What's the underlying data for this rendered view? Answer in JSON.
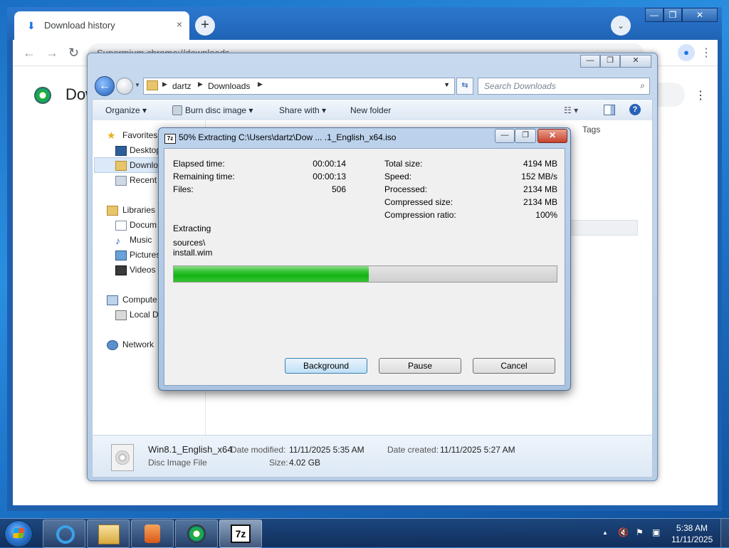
{
  "chrome": {
    "tab_title": "Download history",
    "tab_close": "×",
    "new_tab": "+",
    "tab_search": "⌄",
    "caption": {
      "minimize": "—",
      "restore": "❐",
      "close": "✕"
    },
    "back": "←",
    "forward": "→",
    "reload": "↻",
    "omnibox_text": "Supermium   chrome://downloads",
    "page_title": "Dow",
    "menu": "⋮"
  },
  "explorer": {
    "caption": {
      "minimize": "—",
      "restore": "❐",
      "close": "✕"
    },
    "back": "←",
    "breadcrumbs": [
      "dartz",
      "Downloads"
    ],
    "search_placeholder": "Search Downloads",
    "toolbar": {
      "organize": "Organize ▾",
      "burn": "Burn disc image ▾",
      "share": "Share with ▾",
      "new_folder": "New folder"
    },
    "nav": {
      "favorites": "Favorites",
      "desktop": "Desktop",
      "downloads": "Downlo",
      "recent": "Recent P",
      "libraries": "Libraries",
      "documents": "Docum",
      "music": "Music",
      "pictures": "Pictures",
      "videos": "Videos",
      "computer": "Compute",
      "local_disk": "Local Di",
      "network": "Network"
    },
    "column_tags": "Tags",
    "details": {
      "file_name": "Win8.1_English_x64",
      "file_type": "Disc Image File",
      "date_modified_label": "Date modified:",
      "date_modified": "11/11/2025 5:35 AM",
      "size_label": "Size:",
      "size": "4.02 GB",
      "date_created_label": "Date created:",
      "date_created": "11/11/2025 5:27 AM"
    }
  },
  "zip": {
    "title": "50% Extracting C:\\Users\\dartz\\Dow ... .1_English_x64.iso",
    "caption": {
      "minimize": "—",
      "restore": "❐",
      "close": "✕"
    },
    "left": [
      {
        "label": "Elapsed time:",
        "value": "00:00:14"
      },
      {
        "label": "Remaining time:",
        "value": "00:00:13"
      },
      {
        "label": "Files:",
        "value": "506"
      }
    ],
    "right": [
      {
        "label": "Total size:",
        "value": "4194 MB"
      },
      {
        "label": "Speed:",
        "value": "152 MB/s"
      },
      {
        "label": "Processed:",
        "value": "2134 MB"
      },
      {
        "label": "Compressed size:",
        "value": "2134 MB"
      },
      {
        "label": "Compression ratio:",
        "value": "100%"
      }
    ],
    "status": "Extracting",
    "path_line1": "sources\\",
    "path_line2": "install.wim",
    "progress": 0.51,
    "buttons": {
      "background": "Background",
      "pause": "Pause",
      "cancel": "Cancel"
    }
  },
  "taskbar": {
    "time": "5:38 AM",
    "date": "11/11/2025",
    "tray_arrow": "▲",
    "apps": [
      "internet-explorer",
      "file-explorer",
      "media-player",
      "supermium-browser",
      "7-zip"
    ]
  },
  "colors": {
    "progress_green": "#13b413",
    "accent_blue": "#1f63b5"
  }
}
